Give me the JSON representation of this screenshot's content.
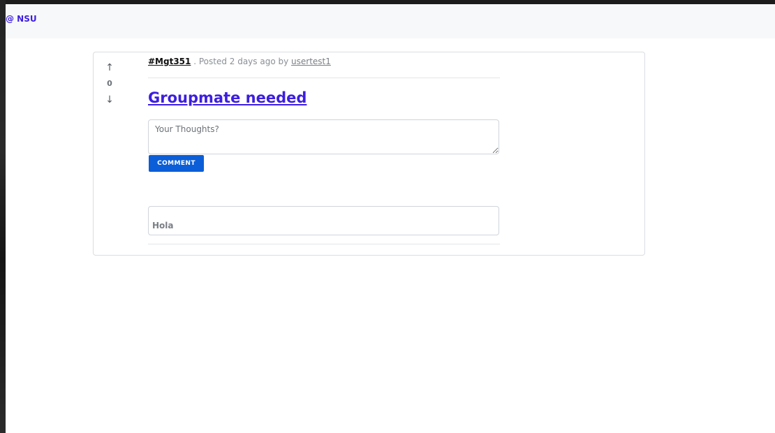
{
  "navbar": {
    "brand": "@ NSU"
  },
  "post": {
    "votes": {
      "up_icon": "arrow-up-icon",
      "count": "0",
      "down_icon": "arrow-down-icon"
    },
    "meta": {
      "tag": "#Mgt351",
      "posted_text": ". Posted 2 days ago by",
      "author": "usertest1"
    },
    "title": "Groupmate needed",
    "comment_input": {
      "placeholder": "Your Thoughts?",
      "value": ""
    },
    "comment_button_label": "COMMENT",
    "comments": [
      {
        "text": "Hola"
      }
    ]
  },
  "colors": {
    "brand": "#3d1ee0",
    "button": "#0b5ed7"
  }
}
